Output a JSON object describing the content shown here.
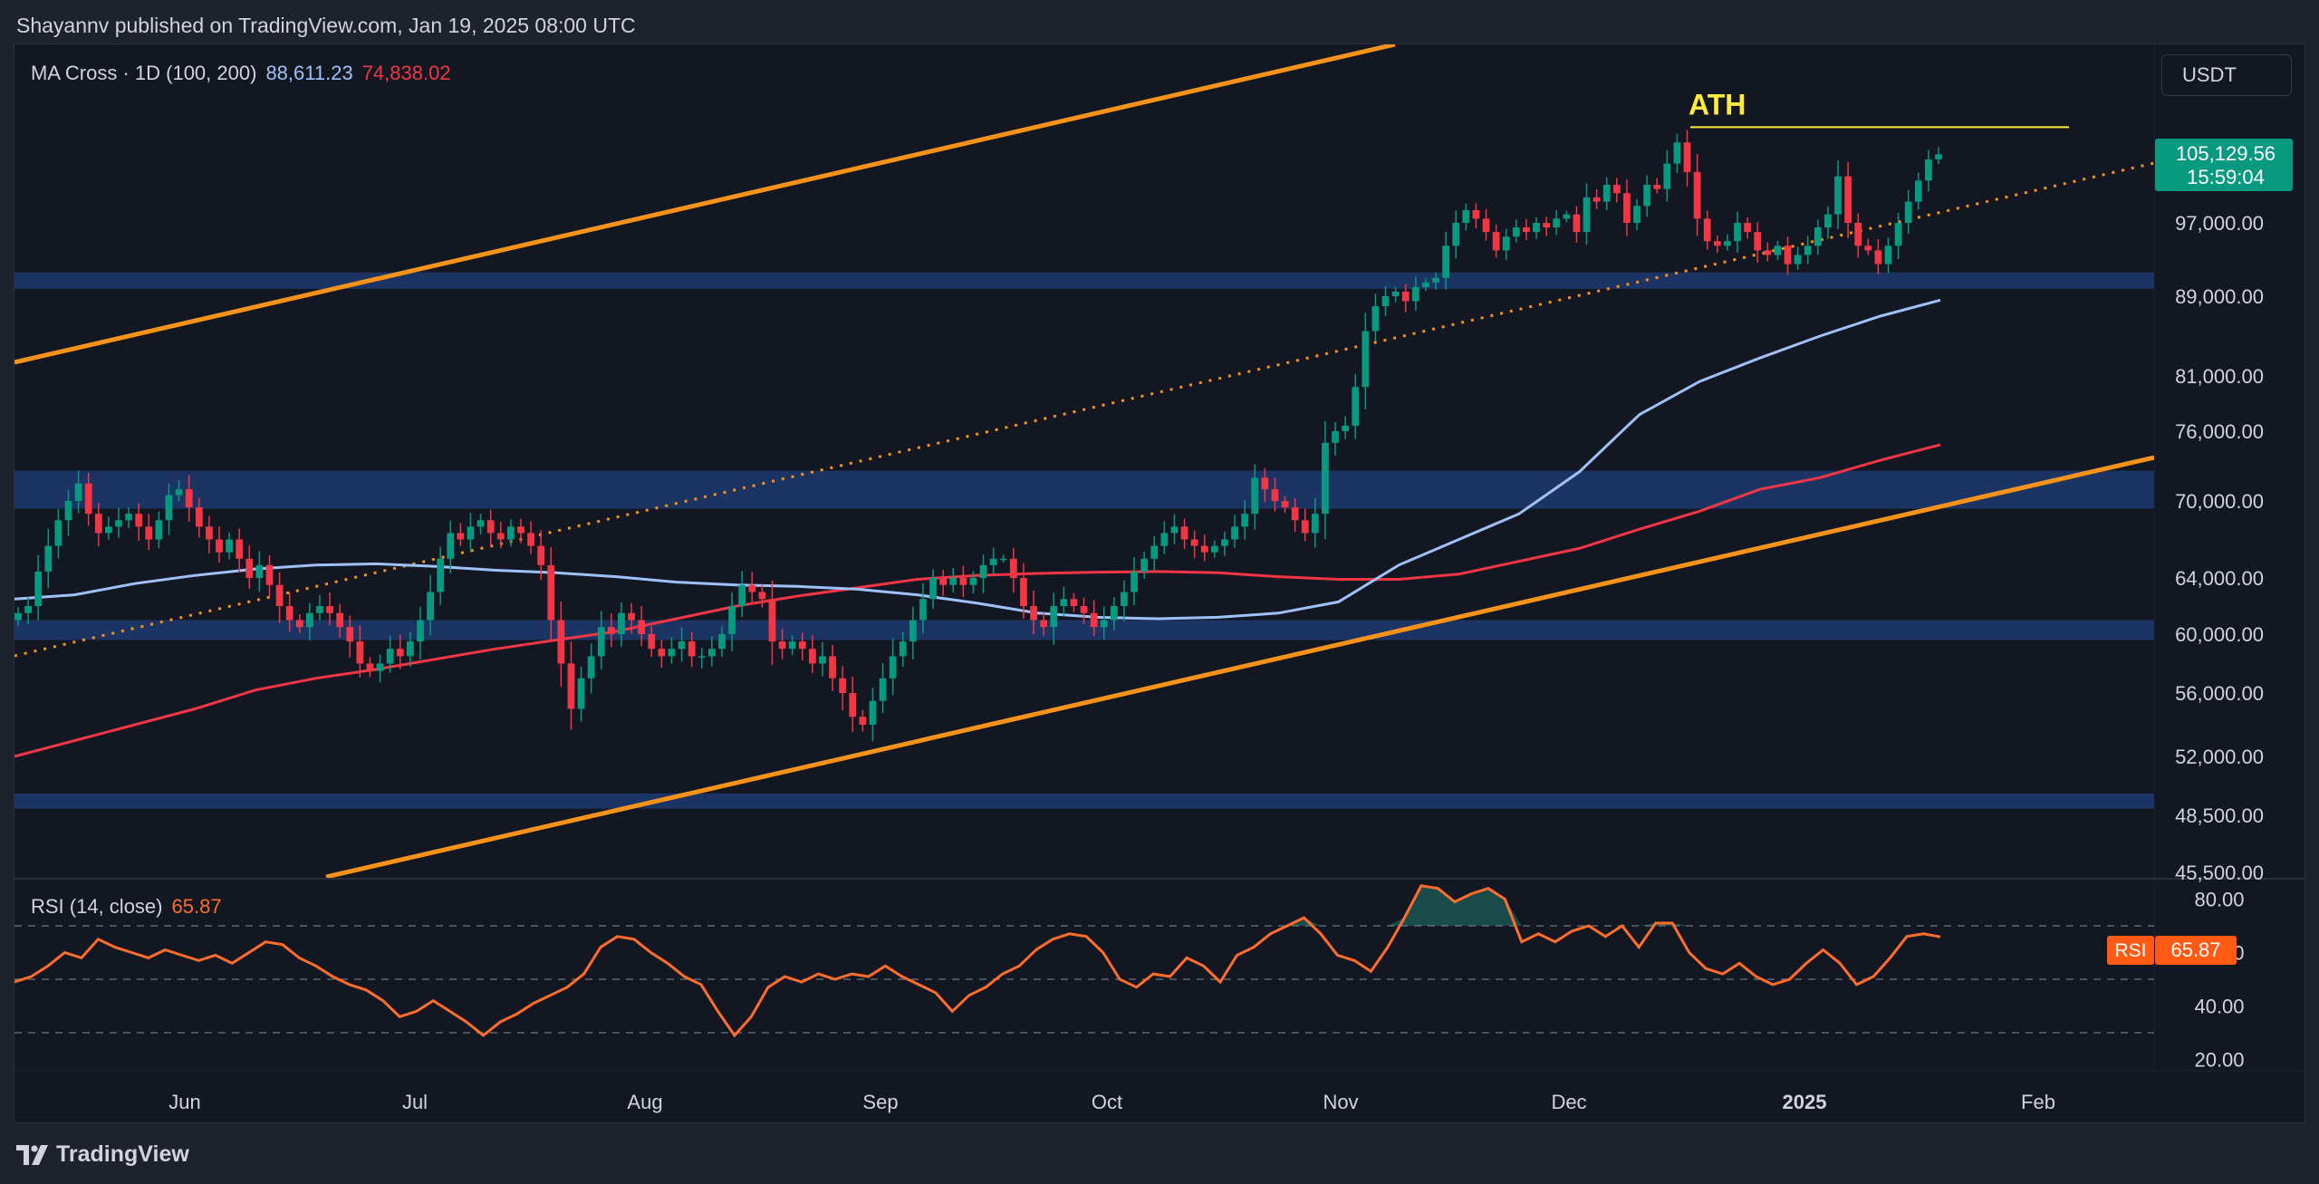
{
  "attribution": "Shayannv published on TradingView.com, Jan 19, 2025 08:00 UTC",
  "legend": {
    "indicator": "MA Cross · 1D (100, 200)",
    "ma100_value": "88,611.23",
    "ma200_value": "74,838.02",
    "rsi_label": "RSI (14, close)",
    "rsi_value": "65.87"
  },
  "currency_button": "USDT",
  "price_tag": {
    "price": "105,129.56",
    "countdown": "15:59:04"
  },
  "rsi_tag": {
    "label": "RSI",
    "value": "65.87"
  },
  "ath_label": "ATH",
  "branding": "TradingView",
  "colors": {
    "background": "#131722",
    "frame": "#1e222d",
    "up_candle": "#089981",
    "down_candle": "#f23645",
    "ma100": "#9ec1f7",
    "ma200": "#f23645",
    "channel": "#f7931a",
    "zones": "#1f3a6e",
    "rsi": "#ff6d2d",
    "ath_line": "#ffeb3b",
    "price_tag": "#089981",
    "rsi_tag": "#ff5a14"
  },
  "chart_data": {
    "type": "candlestick",
    "price_axis_ticks": [
      "105,129.56",
      "97,000.00",
      "89,000.00",
      "81,000.00",
      "76,000.00",
      "70,000.00",
      "64,000.00",
      "60,000.00",
      "56,000.00",
      "52,000.00",
      "48,500.00",
      "45,500.00"
    ],
    "rsi_axis_ticks": [
      "80.00",
      "60.00",
      "40.00",
      "20.00"
    ],
    "time_axis_ticks": [
      "Jun",
      "Jul",
      "Aug",
      "Sep",
      "Oct",
      "Nov",
      "Dec",
      "2025",
      "Feb"
    ],
    "support_resistance_zones": [
      {
        "from": 89800,
        "to": 91600
      },
      {
        "from": 69400,
        "to": 72600
      },
      {
        "from": 59600,
        "to": 61000
      },
      {
        "from": 48900,
        "to": 49800
      }
    ],
    "ath_level": 108300,
    "last_price": 105129.56,
    "ma100_last": 88611.23,
    "ma200_last": 74838.02,
    "rsi_last": 65.87,
    "rsi_levels": [
      70,
      50,
      30
    ],
    "closes": [
      61500,
      62000,
      64500,
      66500,
      68500,
      70000,
      71500,
      69000,
      67500,
      68000,
      68500,
      69000,
      68000,
      67000,
      68500,
      70500,
      71000,
      69500,
      68000,
      67000,
      66000,
      67000,
      65500,
      64000,
      65000,
      63500,
      62000,
      61000,
      60500,
      61500,
      62000,
      61500,
      60500,
      59500,
      58000,
      57500,
      58000,
      59000,
      58500,
      59500,
      61000,
      63000,
      65500,
      67500,
      67000,
      68000,
      68500,
      67500,
      67000,
      68000,
      67500,
      66500,
      65000,
      61000,
      58000,
      55000,
      57000,
      58500,
      60500,
      60000,
      61500,
      61000,
      60000,
      59000,
      58500,
      59000,
      59500,
      58500,
      58500,
      59000,
      60000,
      62000,
      63500,
      63000,
      62500,
      59500,
      59000,
      59500,
      59000,
      58000,
      58500,
      57000,
      56000,
      54500,
      54000,
      55500,
      57000,
      58500,
      59500,
      61000,
      62500,
      64000,
      63500,
      64000,
      63500,
      64000,
      65000,
      65500,
      65500,
      64000,
      62000,
      61000,
      60500,
      62000,
      62500,
      62000,
      61500,
      60500,
      61000,
      62000,
      63000,
      64500,
      65500,
      66500,
      67500,
      68000,
      67000,
      66500,
      66000,
      66500,
      67000,
      68000,
      69000,
      72000,
      71000,
      70000,
      69500,
      68500,
      67500,
      69000,
      75000,
      76000,
      76500,
      80000,
      85500,
      88000,
      89000,
      89500,
      88500,
      90000,
      90500,
      91000,
      94500,
      97000,
      98500,
      97500,
      96000,
      94000,
      95500,
      96500,
      96000,
      97000,
      96500,
      97500,
      98000,
      96000,
      100000,
      99500,
      101500,
      100500,
      97000,
      99000,
      101500,
      101000,
      104000,
      106500,
      103000,
      97500,
      95000,
      94500,
      95000,
      97000,
      96000,
      94000,
      93500,
      94500,
      92500,
      93500,
      94500,
      96500,
      98000,
      102500,
      97000,
      94500,
      94000,
      92500,
      94500,
      97000,
      99500,
      102000,
      104500,
      105100
    ],
    "ma100": [
      62500,
      62800,
      63600,
      64200,
      64700,
      65000,
      65100,
      64900,
      64600,
      64400,
      64100,
      63700,
      63500,
      63400,
      63200,
      62800,
      62200,
      61500,
      61200,
      61100,
      61200,
      61500,
      62300,
      65000,
      67000,
      69000,
      72500,
      77500,
      80500,
      82800,
      85000,
      87000,
      88611
    ],
    "ma200": [
      52000,
      53000,
      54000,
      55000,
      56200,
      57000,
      57600,
      58300,
      59000,
      59600,
      60200,
      61100,
      62000,
      62700,
      63300,
      63900,
      64200,
      64350,
      64450,
      64500,
      64400,
      64100,
      63900,
      63900,
      64300,
      65300,
      66300,
      67800,
      69200,
      71000,
      72000,
      73500,
      74838
    ],
    "rsi": [
      49,
      51,
      55,
      60,
      58,
      65,
      62,
      60,
      58,
      61,
      59,
      57,
      59,
      56,
      60,
      64,
      63,
      58,
      55,
      51,
      48,
      46,
      42,
      36,
      38,
      42,
      38,
      34,
      29,
      34,
      37,
      41,
      44,
      47,
      52,
      62,
      66,
      65,
      60,
      56,
      51,
      48,
      38,
      29,
      36,
      47,
      51,
      49,
      52,
      50,
      52,
      51,
      55,
      51,
      48,
      45,
      38,
      44,
      47,
      52,
      55,
      61,
      65,
      67,
      66,
      60,
      50,
      47,
      52,
      51,
      58,
      55,
      49,
      59,
      62,
      67,
      70,
      73,
      67,
      59,
      57,
      53,
      62,
      73,
      85,
      84,
      79,
      82,
      84,
      80,
      64,
      67,
      64,
      68,
      70,
      66,
      70,
      62,
      71,
      71,
      60,
      54,
      52,
      56,
      51,
      48,
      50,
      56,
      61,
      56,
      48,
      51,
      58,
      66,
      67,
      65.87
    ]
  }
}
